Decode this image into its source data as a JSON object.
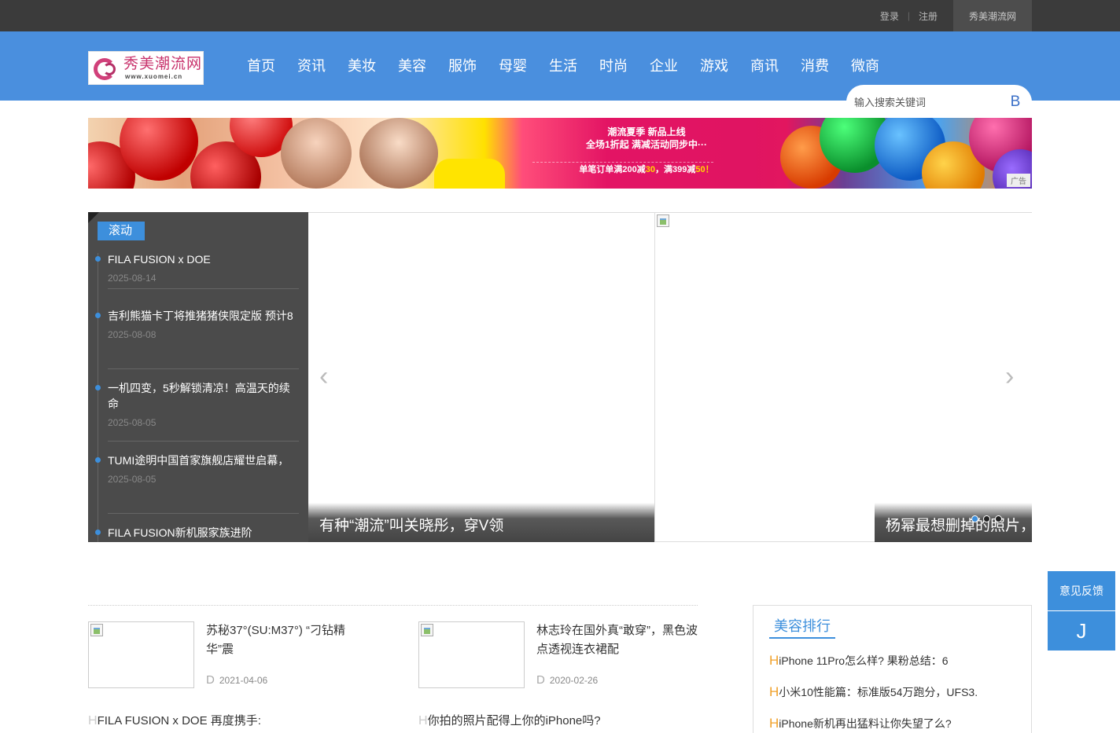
{
  "topbar": {
    "login": "登录",
    "register": "注册",
    "site_name": "秀美潮流网"
  },
  "logo": {
    "name": "秀美潮流网",
    "domain": "www.xuomei.cn"
  },
  "nav": [
    "首页",
    "资讯",
    "美妆",
    "美容",
    "服饰",
    "母婴",
    "生活",
    "时尚",
    "企业",
    "游戏",
    "商讯",
    "消费",
    "微商"
  ],
  "search": {
    "placeholder": "输入搜索关键词",
    "button_glyph": "B"
  },
  "banner": {
    "line1": "潮流夏季  新品上线",
    "line2": "全场1折起  满减活动同步中···",
    "line3_pre": "单笔订单满200减",
    "line3_a": "30",
    "line3_mid": "，满399减",
    "line3_b": "50",
    "line3_end": "！",
    "ad_tag": "广告"
  },
  "feed": {
    "tag": "滚动",
    "items": [
      {
        "title": "FILA FUSION x DOE",
        "date": "2025-08-14"
      },
      {
        "title": "吉利熊猫卡丁将推猪猪侠限定版 预计8",
        "date": "2025-08-08"
      },
      {
        "title": "一机四变，5秒解锁清凉！高温天的续命",
        "date": "2025-08-05"
      },
      {
        "title": "TUMI途明中国首家旗舰店耀世启幕，",
        "date": "2025-08-05"
      },
      {
        "title": "FILA FUSION新机服家族进阶",
        "date": ""
      }
    ]
  },
  "slider": {
    "caption1": "有种“潮流”叫关晓彤，穿V领",
    "caption2": "杨幂最想删掉的照片，",
    "prev_glyph": "‹",
    "next_glyph": "›"
  },
  "float": {
    "feedback": "意见反馈",
    "top_glyph": "J"
  },
  "articles": [
    {
      "title": "苏秘37°(SU:M37°) “刁钻精华”震",
      "date_prefix": "D",
      "date": "2021-04-06",
      "sub_prefix": "H",
      "sub": "FILA FUSION x DOE 再度携手:"
    },
    {
      "title": "林志玲在国外真“敢穿”，黑色波点透视连衣裙配",
      "date_prefix": "D",
      "date": "2020-02-26",
      "sub_prefix": "H",
      "sub": "你拍的照片配得上你的iPhone吗?"
    }
  ],
  "ranking": {
    "title": "美容排行",
    "items": [
      {
        "prefix": "H",
        "text": "iPhone 11Pro怎么样? 果粉总结：6"
      },
      {
        "prefix": "H",
        "text": "小米10性能篇：标准版54万跑分，UFS3."
      },
      {
        "prefix": "H",
        "text": "iPhone新机再出猛料让你失望了么?"
      }
    ]
  },
  "colors": {
    "topbar": "#3b3b3b",
    "nav": "#4a8fde",
    "accent": "#3d8fdc",
    "rank_prefix": "#f0a028"
  }
}
